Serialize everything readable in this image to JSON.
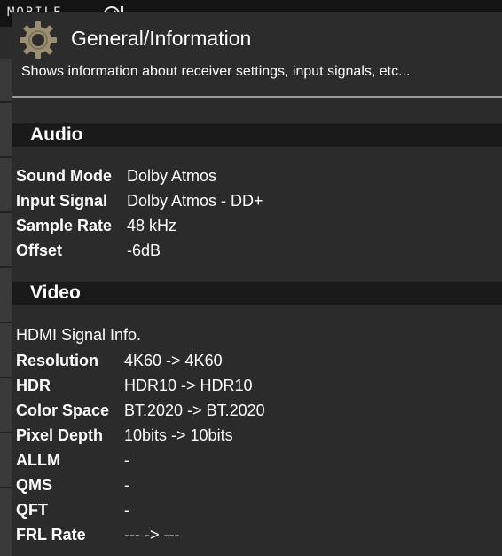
{
  "watermark": {
    "text": "MOBILE"
  },
  "header": {
    "icon": "gear-icon",
    "title": "General/Information",
    "description": "Shows information about receiver settings, input signals, etc..."
  },
  "audio": {
    "heading": "Audio",
    "rows": [
      {
        "label": "Sound Mode",
        "value": "Dolby Atmos"
      },
      {
        "label": "Input Signal",
        "value": "Dolby Atmos - DD+"
      },
      {
        "label": "Sample Rate",
        "value": "48 kHz"
      },
      {
        "label": "Offset",
        "value": "-6dB"
      }
    ]
  },
  "video": {
    "heading": "Video",
    "subheading": "HDMI Signal Info.",
    "rows": [
      {
        "label": "Resolution",
        "value": "4K60 -> 4K60"
      },
      {
        "label": "HDR",
        "value": "HDR10 -> HDR10"
      },
      {
        "label": "Color Space",
        "value": "BT.2020 -> BT.2020"
      },
      {
        "label": "Pixel Depth",
        "value": "10bits -> 10bits"
      },
      {
        "label": "ALLM",
        "value": "-"
      },
      {
        "label": "QMS",
        "value": "-"
      },
      {
        "label": "QFT",
        "value": "-"
      },
      {
        "label": "FRL Rate",
        "value": "--- -> ---"
      }
    ]
  },
  "colors": {
    "background": "#2b2b2b",
    "section_bar": "#1a1a1a",
    "text": "#ffffff"
  }
}
